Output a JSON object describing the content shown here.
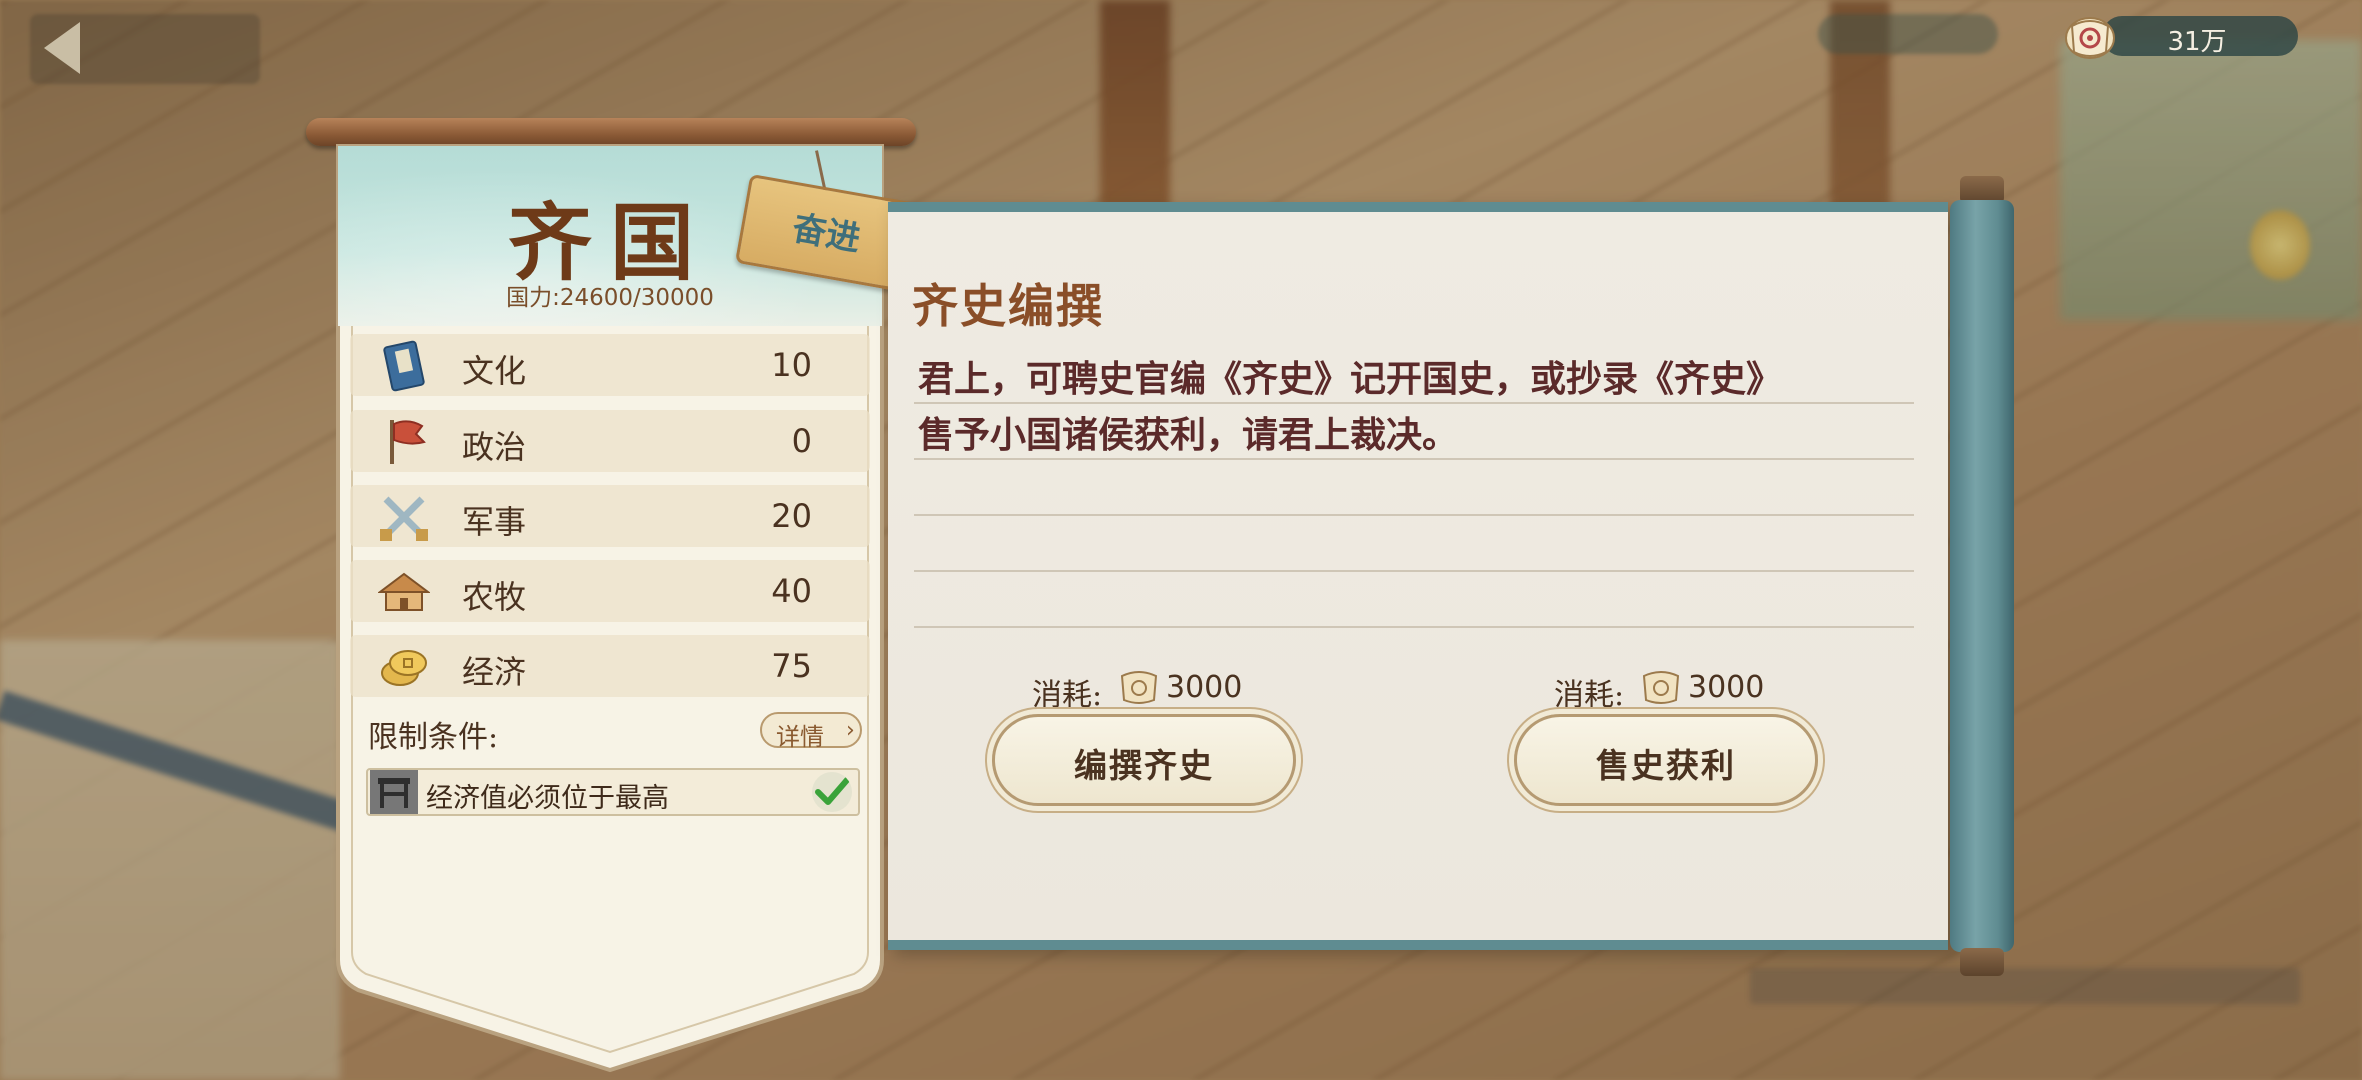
{
  "currency": {
    "amount": "31万",
    "icon": "scroll-coin-icon"
  },
  "nation": {
    "name": "齐国",
    "power": "国力:24600/30000",
    "tag": "奋进",
    "stats": [
      {
        "label": "文化",
        "value": "10",
        "icon": "book-icon"
      },
      {
        "label": "政治",
        "value": "0",
        "icon": "flag-icon"
      },
      {
        "label": "军事",
        "value": "20",
        "icon": "crossed-swords-icon"
      },
      {
        "label": "农牧",
        "value": "40",
        "icon": "farmhouse-icon"
      },
      {
        "label": "经济",
        "value": "75",
        "icon": "coins-icon"
      }
    ],
    "restriction_label": "限制条件:",
    "detail_button": "详情",
    "condition": {
      "text": "经济值必须位于最高",
      "met": true
    }
  },
  "event": {
    "title": "齐史编撰",
    "lines": [
      "君上，可聘史官编《齐史》记开国史，或抄录《齐史》",
      "售予小国诸侯获利，请君上裁决。"
    ],
    "options": [
      {
        "cost_label": "消耗:",
        "cost_value": "3000",
        "button": "编撰齐史"
      },
      {
        "cost_label": "消耗:",
        "cost_value": "3000",
        "button": "售史获利"
      }
    ]
  },
  "colors": {
    "scroll_border": "#5f8c91",
    "title_brown": "#8a4e28",
    "text_maroon": "#5b2a2a",
    "banner_teal": "#b5dcd6"
  }
}
